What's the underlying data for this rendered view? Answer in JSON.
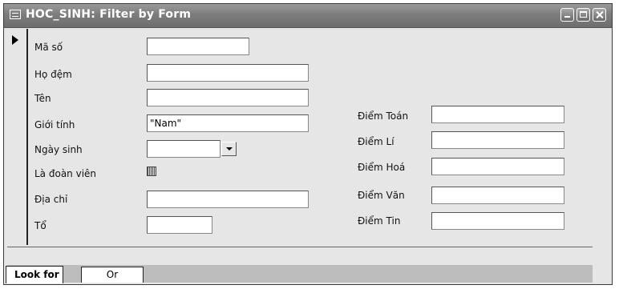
{
  "window": {
    "title": "HOC_SINH: Filter by Form"
  },
  "form": {
    "left_fields": [
      {
        "label": "Mã số",
        "value": ""
      },
      {
        "label": "Họ đệm",
        "value": ""
      },
      {
        "label": "Tên",
        "value": ""
      },
      {
        "label": "Giới tính",
        "value": "\"Nam\""
      },
      {
        "label": "Ngày sinh",
        "value": ""
      },
      {
        "label": "Là đoàn viên",
        "value": ""
      },
      {
        "label": "Địa chỉ",
        "value": ""
      },
      {
        "label": "Tổ",
        "value": ""
      }
    ],
    "right_fields": [
      {
        "label": "Điểm Toán",
        "value": ""
      },
      {
        "label": "Điểm Lí",
        "value": ""
      },
      {
        "label": "Điểm Hoá",
        "value": ""
      },
      {
        "label": "Điểm Văn",
        "value": ""
      },
      {
        "label": "Điểm Tin",
        "value": ""
      }
    ]
  },
  "tabs": {
    "look_for": "Look for",
    "or": "Or"
  }
}
